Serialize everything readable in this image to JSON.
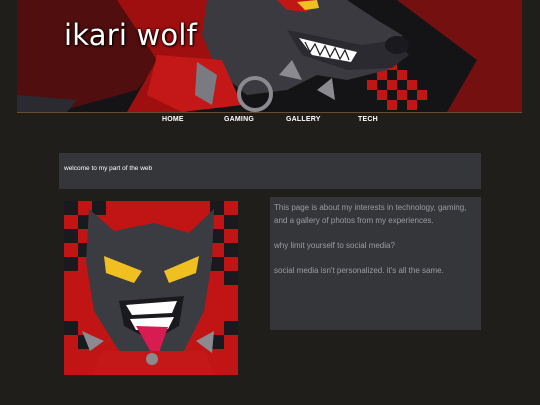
{
  "header": {
    "title": "ikari wolf"
  },
  "nav": {
    "items": [
      {
        "label": "HOME"
      },
      {
        "label": "GAMING"
      },
      {
        "label": "GALLERY"
      },
      {
        "label": "TECH"
      }
    ]
  },
  "welcome": {
    "text": "welcome to my part of the web"
  },
  "content": {
    "paragraphs": [
      "This page is about my interests in technology, gaming, and a gallery of photos from my experiences.",
      "why limit yourself to social media?",
      "social media isn't personalized. it's all the same."
    ]
  },
  "colors": {
    "background": "#1f1e1b",
    "panel": "#35363a",
    "accent_red": "#d01818",
    "body_text": "#9a9ca2"
  }
}
